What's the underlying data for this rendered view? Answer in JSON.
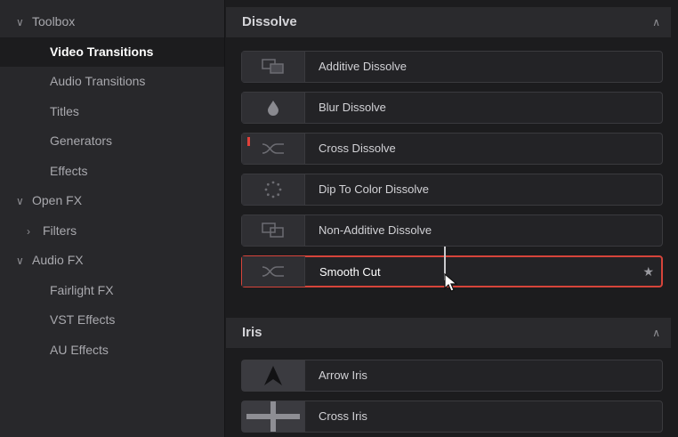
{
  "sidebar": {
    "items": [
      {
        "label": "Toolbox",
        "level": "top",
        "chevron": "down"
      },
      {
        "label": "Video Transitions",
        "level": "sub",
        "active": true
      },
      {
        "label": "Audio Transitions",
        "level": "sub"
      },
      {
        "label": "Titles",
        "level": "sub"
      },
      {
        "label": "Generators",
        "level": "sub"
      },
      {
        "label": "Effects",
        "level": "sub"
      },
      {
        "label": "Open FX",
        "level": "top",
        "chevron": "down"
      },
      {
        "label": "Filters",
        "level": "top",
        "chevron": "right"
      },
      {
        "label": "Audio FX",
        "level": "top",
        "chevron": "down"
      },
      {
        "label": "Fairlight FX",
        "level": "sub"
      },
      {
        "label": "VST Effects",
        "level": "sub"
      },
      {
        "label": "AU Effects",
        "level": "sub"
      }
    ]
  },
  "sections": {
    "dissolve": {
      "title": "Dissolve",
      "items": [
        {
          "label": "Additive Dissolve",
          "icon": "additive-dissolve-icon"
        },
        {
          "label": "Blur Dissolve",
          "icon": "blur-drop-icon"
        },
        {
          "label": "Cross Dissolve",
          "icon": "cross-dissolve-icon"
        },
        {
          "label": "Dip To Color Dissolve",
          "icon": "dip-to-color-icon"
        },
        {
          "label": "Non-Additive Dissolve",
          "icon": "non-additive-dissolve-icon"
        },
        {
          "label": "Smooth Cut",
          "icon": "smooth-cut-icon"
        }
      ]
    },
    "iris": {
      "title": "Iris",
      "items": [
        {
          "label": "Arrow Iris",
          "icon": "arrow-iris-icon"
        },
        {
          "label": "Cross Iris",
          "icon": "cross-iris-icon"
        }
      ]
    }
  },
  "colors": {
    "accent": "#d6443a",
    "sidebar_bg": "#28282b",
    "panel_bg": "#1c1c1e"
  }
}
